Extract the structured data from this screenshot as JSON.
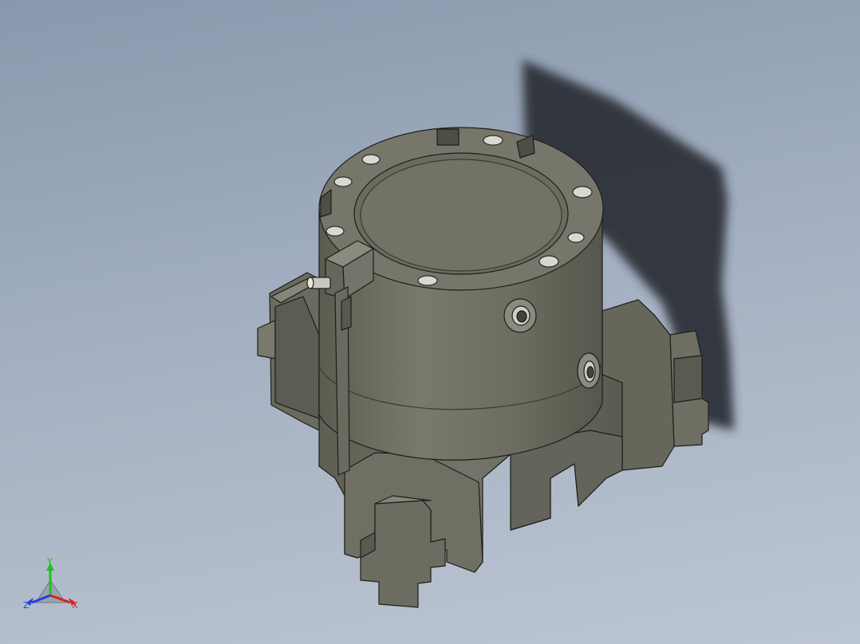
{
  "viewport": {
    "background_top": "#8a98ad",
    "background_bottom": "#bcc5d2",
    "model_color": "#6e6e62",
    "model_shade_light": "#7b7b6e",
    "model_shade_dark": "#55554b",
    "shadow_color": "#2b2f36"
  },
  "triad": {
    "x_label": "X",
    "y_label": "Y",
    "z_label": "Z",
    "x_color": "#d92020",
    "y_color": "#20c020",
    "z_color": "#2040e0"
  }
}
